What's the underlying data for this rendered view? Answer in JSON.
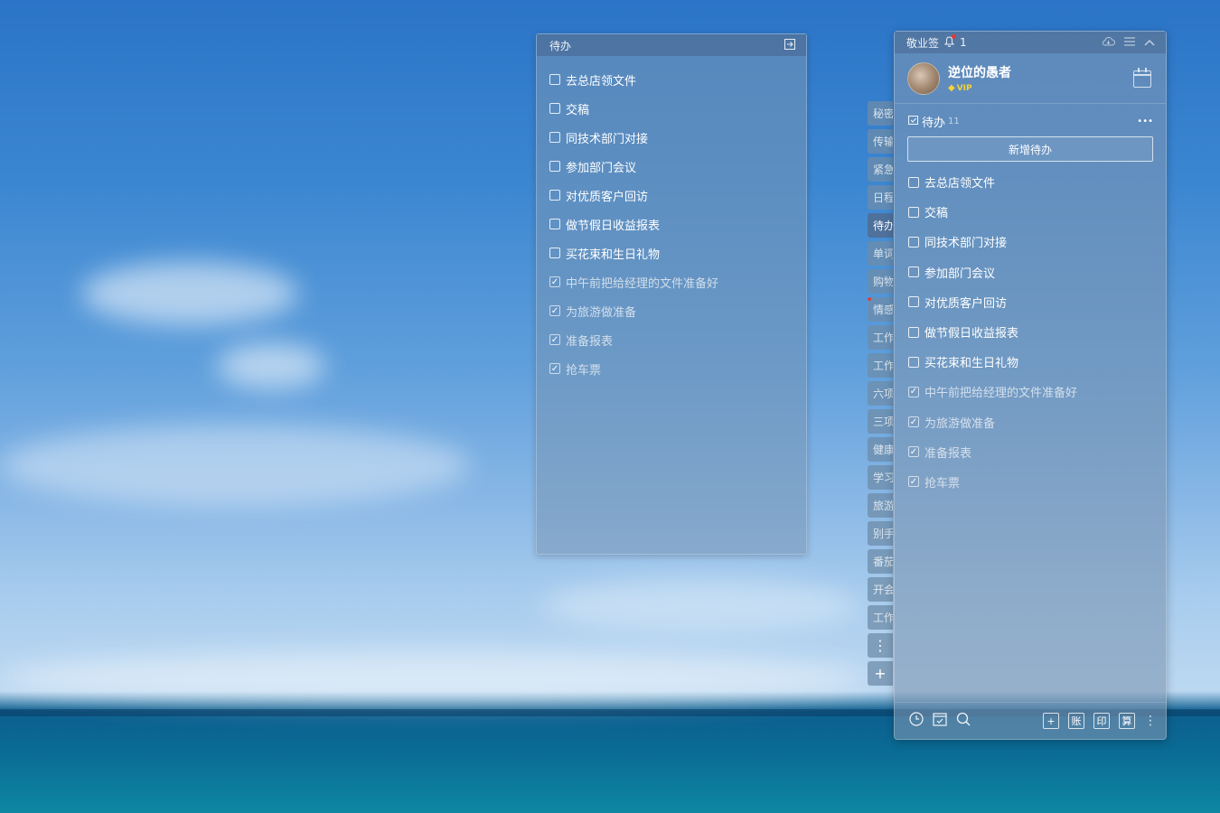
{
  "left_panel": {
    "title": "待办",
    "items": [
      {
        "text": "去总店领文件",
        "done": false
      },
      {
        "text": "交稿",
        "done": false
      },
      {
        "text": "同技术部门对接",
        "done": false
      },
      {
        "text": "参加部门会议",
        "done": false
      },
      {
        "text": "对优质客户回访",
        "done": false
      },
      {
        "text": "做节假日收益报表",
        "done": false
      },
      {
        "text": "买花束和生日礼物",
        "done": false
      },
      {
        "text": "中午前把给经理的文件准备好",
        "done": true
      },
      {
        "text": "为旅游做准备",
        "done": true
      },
      {
        "text": "准备报表",
        "done": true
      },
      {
        "text": "抢车票",
        "done": true
      }
    ]
  },
  "tabs": [
    {
      "label": "秘密"
    },
    {
      "label": "传输"
    },
    {
      "label": "紧急"
    },
    {
      "label": "日程"
    },
    {
      "label": "待办",
      "active": true
    },
    {
      "label": "单词"
    },
    {
      "label": "购物"
    },
    {
      "label": "情感",
      "dot": true
    },
    {
      "label": "工作"
    },
    {
      "label": "工作"
    },
    {
      "label": "六项"
    },
    {
      "label": "三项"
    },
    {
      "label": "健康"
    },
    {
      "label": "学习"
    },
    {
      "label": "旅游"
    },
    {
      "label": "别手"
    },
    {
      "label": "番茄"
    },
    {
      "label": "开会"
    },
    {
      "label": "工作"
    }
  ],
  "main_panel": {
    "app_name": "敬业签",
    "notification_count": "1",
    "user": {
      "name": "逆位的愚者",
      "badge": "VIP"
    },
    "section": {
      "title": "待办",
      "count": "11",
      "more": "•••"
    },
    "add_button": "新增待办",
    "items": [
      {
        "text": "去总店领文件",
        "done": false
      },
      {
        "text": "交稿",
        "done": false
      },
      {
        "text": "同技术部门对接",
        "done": false
      },
      {
        "text": "参加部门会议",
        "done": false
      },
      {
        "text": "对优质客户回访",
        "done": false
      },
      {
        "text": "做节假日收益报表",
        "done": false
      },
      {
        "text": "买花束和生日礼物",
        "done": false
      },
      {
        "text": "中午前把给经理的文件准备好",
        "done": true
      },
      {
        "text": "为旅游做准备",
        "done": true
      },
      {
        "text": "准备报表",
        "done": true
      },
      {
        "text": "抢车票",
        "done": true
      }
    ],
    "footer_tools": [
      "+",
      "账",
      "印",
      "算"
    ]
  }
}
